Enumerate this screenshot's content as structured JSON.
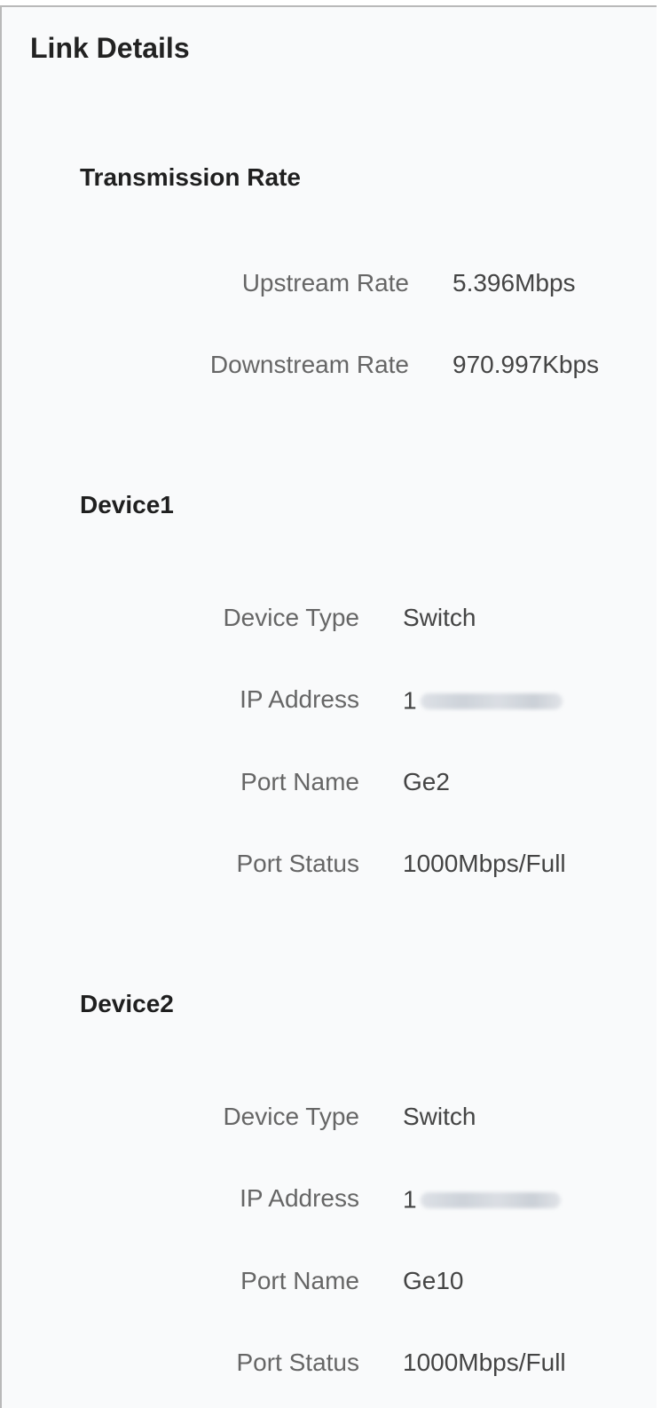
{
  "title": "Link Details",
  "transmission": {
    "heading": "Transmission Rate",
    "upstream_label": "Upstream Rate",
    "upstream_value": "5.396Mbps",
    "downstream_label": "Downstream Rate",
    "downstream_value": "970.997Kbps"
  },
  "device1": {
    "heading": "Device1",
    "type_label": "Device Type",
    "type_value": "Switch",
    "ip_label": "IP Address",
    "ip_visible_prefix": "1",
    "port_name_label": "Port Name",
    "port_name_value": "Ge2",
    "port_status_label": "Port Status",
    "port_status_value": "1000Mbps/Full"
  },
  "device2": {
    "heading": "Device2",
    "type_label": "Device Type",
    "type_value": "Switch",
    "ip_label": "IP Address",
    "ip_visible_prefix": "1",
    "port_name_label": "Port Name",
    "port_name_value": "Ge10",
    "port_status_label": "Port Status",
    "port_status_value": "1000Mbps/Full"
  }
}
